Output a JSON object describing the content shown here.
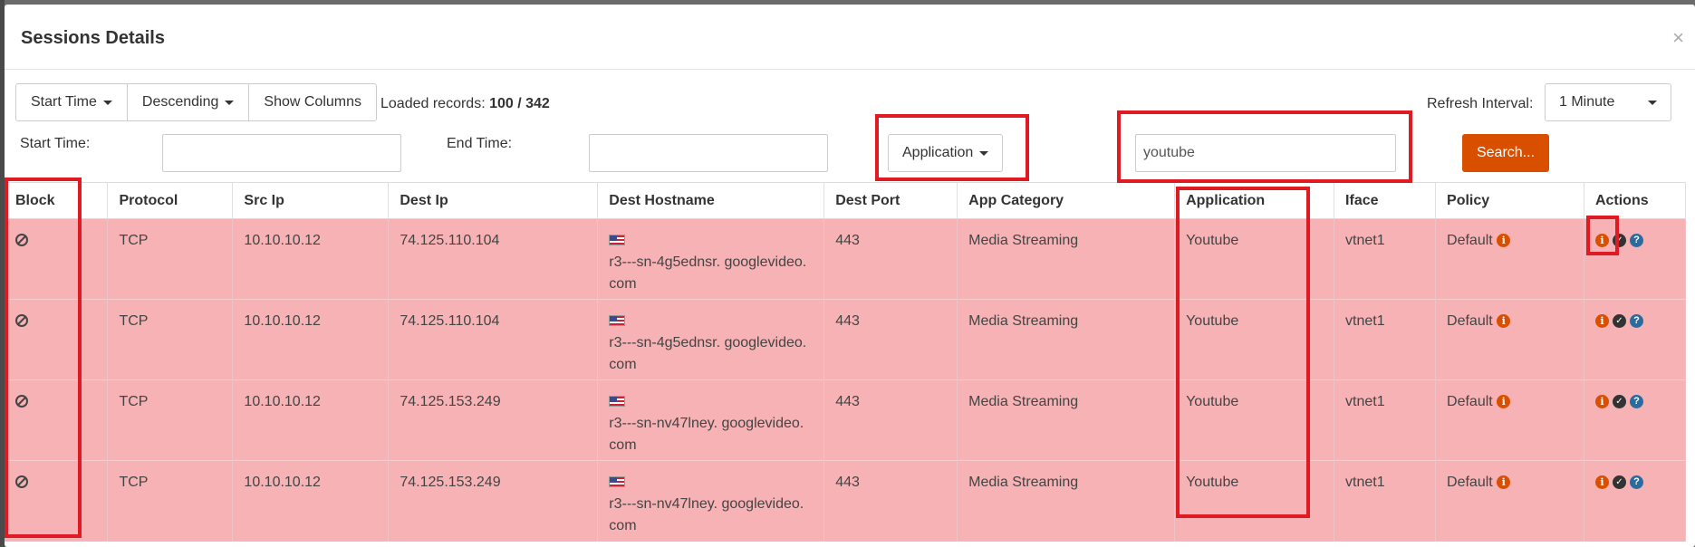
{
  "modal": {
    "title": "Sessions Details",
    "close": "×"
  },
  "toolbar": {
    "start_time_btn": "Start Time",
    "order_btn": "Descending",
    "columns_btn": "Show Columns",
    "loaded_label": "Loaded records:",
    "loaded_value": "100 / 342",
    "refresh_label": "Refresh Interval:",
    "refresh_value": "1 Minute"
  },
  "filters": {
    "start_label": "Start Time:",
    "end_label": "End Time:",
    "field_select": "Application",
    "search_value": "youtube",
    "search_btn": "Search..."
  },
  "table": {
    "headers": [
      "Block",
      "Protocol",
      "Src Ip",
      "Dest Ip",
      "Dest Hostname",
      "Dest Port",
      "App Category",
      "Application",
      "Iface",
      "Policy",
      "Actions"
    ],
    "rows": [
      {
        "protocol": "TCP",
        "src": "10.10.10.12",
        "dest": "74.125.110.104",
        "host1": "r3---sn-4g5ednsr. googlevideo.",
        "host2": "com",
        "port": "443",
        "category": "Media Streaming",
        "app": "Youtube",
        "iface": "vtnet1",
        "policy": "Default"
      },
      {
        "protocol": "TCP",
        "src": "10.10.10.12",
        "dest": "74.125.110.104",
        "host1": "r3---sn-4g5ednsr. googlevideo.",
        "host2": "com",
        "port": "443",
        "category": "Media Streaming",
        "app": "Youtube",
        "iface": "vtnet1",
        "policy": "Default"
      },
      {
        "protocol": "TCP",
        "src": "10.10.10.12",
        "dest": "74.125.153.249",
        "host1": "r3---sn-nv47lney. googlevideo.",
        "host2": "com",
        "port": "443",
        "category": "Media Streaming",
        "app": "Youtube",
        "iface": "vtnet1",
        "policy": "Default"
      },
      {
        "protocol": "TCP",
        "src": "10.10.10.12",
        "dest": "74.125.153.249",
        "host1": "r3---sn-nv47lney. googlevideo.",
        "host2": "com",
        "port": "443",
        "category": "Media Streaming",
        "app": "Youtube",
        "iface": "vtnet1",
        "policy": "Default"
      }
    ]
  },
  "colors": {
    "row_bg": "#f7b2b5",
    "accent": "#d94f00",
    "highlight": "#e01a22"
  }
}
